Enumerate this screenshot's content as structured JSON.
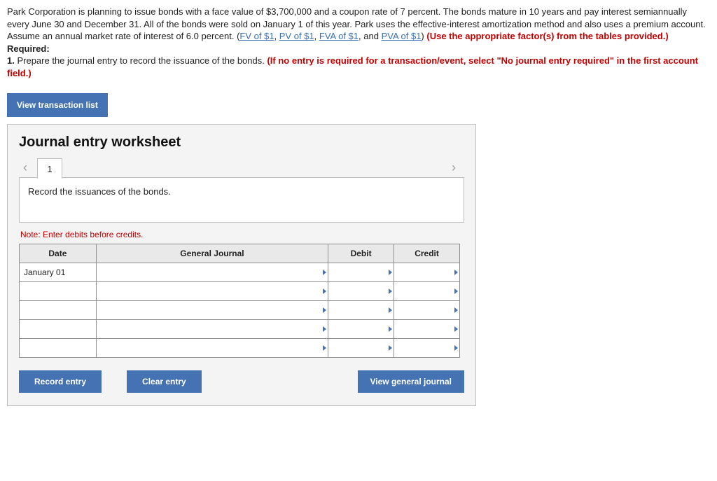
{
  "problem": {
    "p1a": "Park Corporation is planning to issue bonds with a face value of $3,700,000 and a coupon rate of 7 percent. The bonds mature in 10 years and pay interest semiannually every June 30 and December 31. All of the bonds were sold on January 1 of this year. Park uses the effective-interest amortization method and also uses a premium account. Assume an annual market rate of interest of 6.0 percent. (",
    "link_fv": "FV of $1",
    "sep": ", ",
    "link_pv": "PV of $1",
    "link_fva": "FVA of $1",
    "and": ", and ",
    "link_pva": "PVA of $1",
    "close_paren": ") ",
    "usef": "(Use the appropriate factor(s) from the tables provided.)",
    "required_label": "Required:",
    "req1_lead": "1. ",
    "req1_text": "Prepare the journal entry to record the issuance of the bonds. ",
    "req1_red": "(If no entry is required for a transaction/event, select \"No journal entry required\" in the first account field.)"
  },
  "buttons": {
    "view_trans": "View transaction list",
    "record": "Record entry",
    "clear": "Clear entry",
    "view_gj": "View general journal"
  },
  "worksheet": {
    "title": "Journal entry worksheet",
    "tab1": "1",
    "instruction": "Record the issuances of the bonds.",
    "note": "Note: Enter debits before credits.",
    "headers": {
      "date": "Date",
      "gj": "General Journal",
      "debit": "Debit",
      "credit": "Credit"
    },
    "row1_date": "January 01"
  }
}
